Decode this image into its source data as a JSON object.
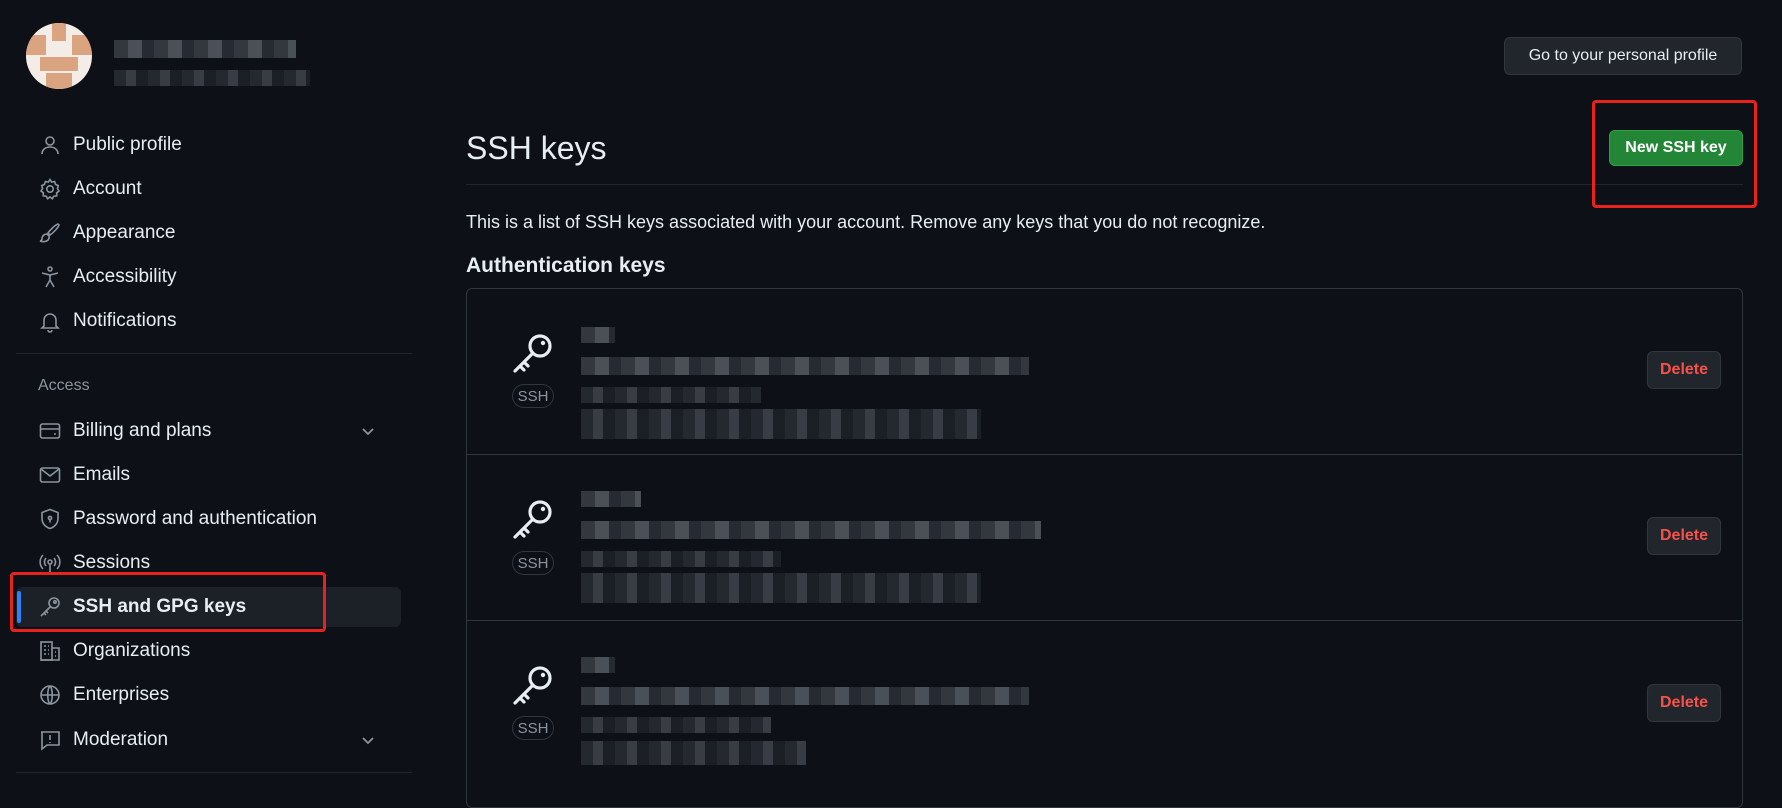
{
  "header": {
    "profile_button": "Go to your personal profile"
  },
  "sidebar": {
    "items": [
      {
        "label": "Public profile",
        "icon": "person-icon"
      },
      {
        "label": "Account",
        "icon": "gear-icon"
      },
      {
        "label": "Appearance",
        "icon": "paintbrush-icon"
      },
      {
        "label": "Accessibility",
        "icon": "accessibility-icon"
      },
      {
        "label": "Notifications",
        "icon": "bell-icon"
      }
    ],
    "access_label": "Access",
    "access_items": [
      {
        "label": "Billing and plans",
        "icon": "credit-card-icon",
        "expandable": true
      },
      {
        "label": "Emails",
        "icon": "mail-icon"
      },
      {
        "label": "Password and authentication",
        "icon": "shield-lock-icon"
      },
      {
        "label": "Sessions",
        "icon": "broadcast-icon"
      },
      {
        "label": "SSH and GPG keys",
        "icon": "key-icon",
        "active": true
      },
      {
        "label": "Organizations",
        "icon": "organization-icon"
      },
      {
        "label": "Enterprises",
        "icon": "globe-icon"
      },
      {
        "label": "Moderation",
        "icon": "report-icon",
        "expandable": true
      }
    ]
  },
  "main": {
    "title": "SSH keys",
    "new_key_button": "New SSH key",
    "description": "This is a list of SSH keys associated with your account. Remove any keys that you do not recognize.",
    "section_title": "Authentication keys",
    "keys": [
      {
        "badge": "SSH",
        "delete_label": "Delete"
      },
      {
        "badge": "SSH",
        "delete_label": "Delete"
      },
      {
        "badge": "SSH",
        "delete_label": "Delete"
      }
    ]
  },
  "colors": {
    "background": "#0d1117",
    "accent_green": "#238636",
    "danger_red": "#f85149",
    "active_indicator": "#2f81f7",
    "highlight_box": "#e8231e"
  }
}
